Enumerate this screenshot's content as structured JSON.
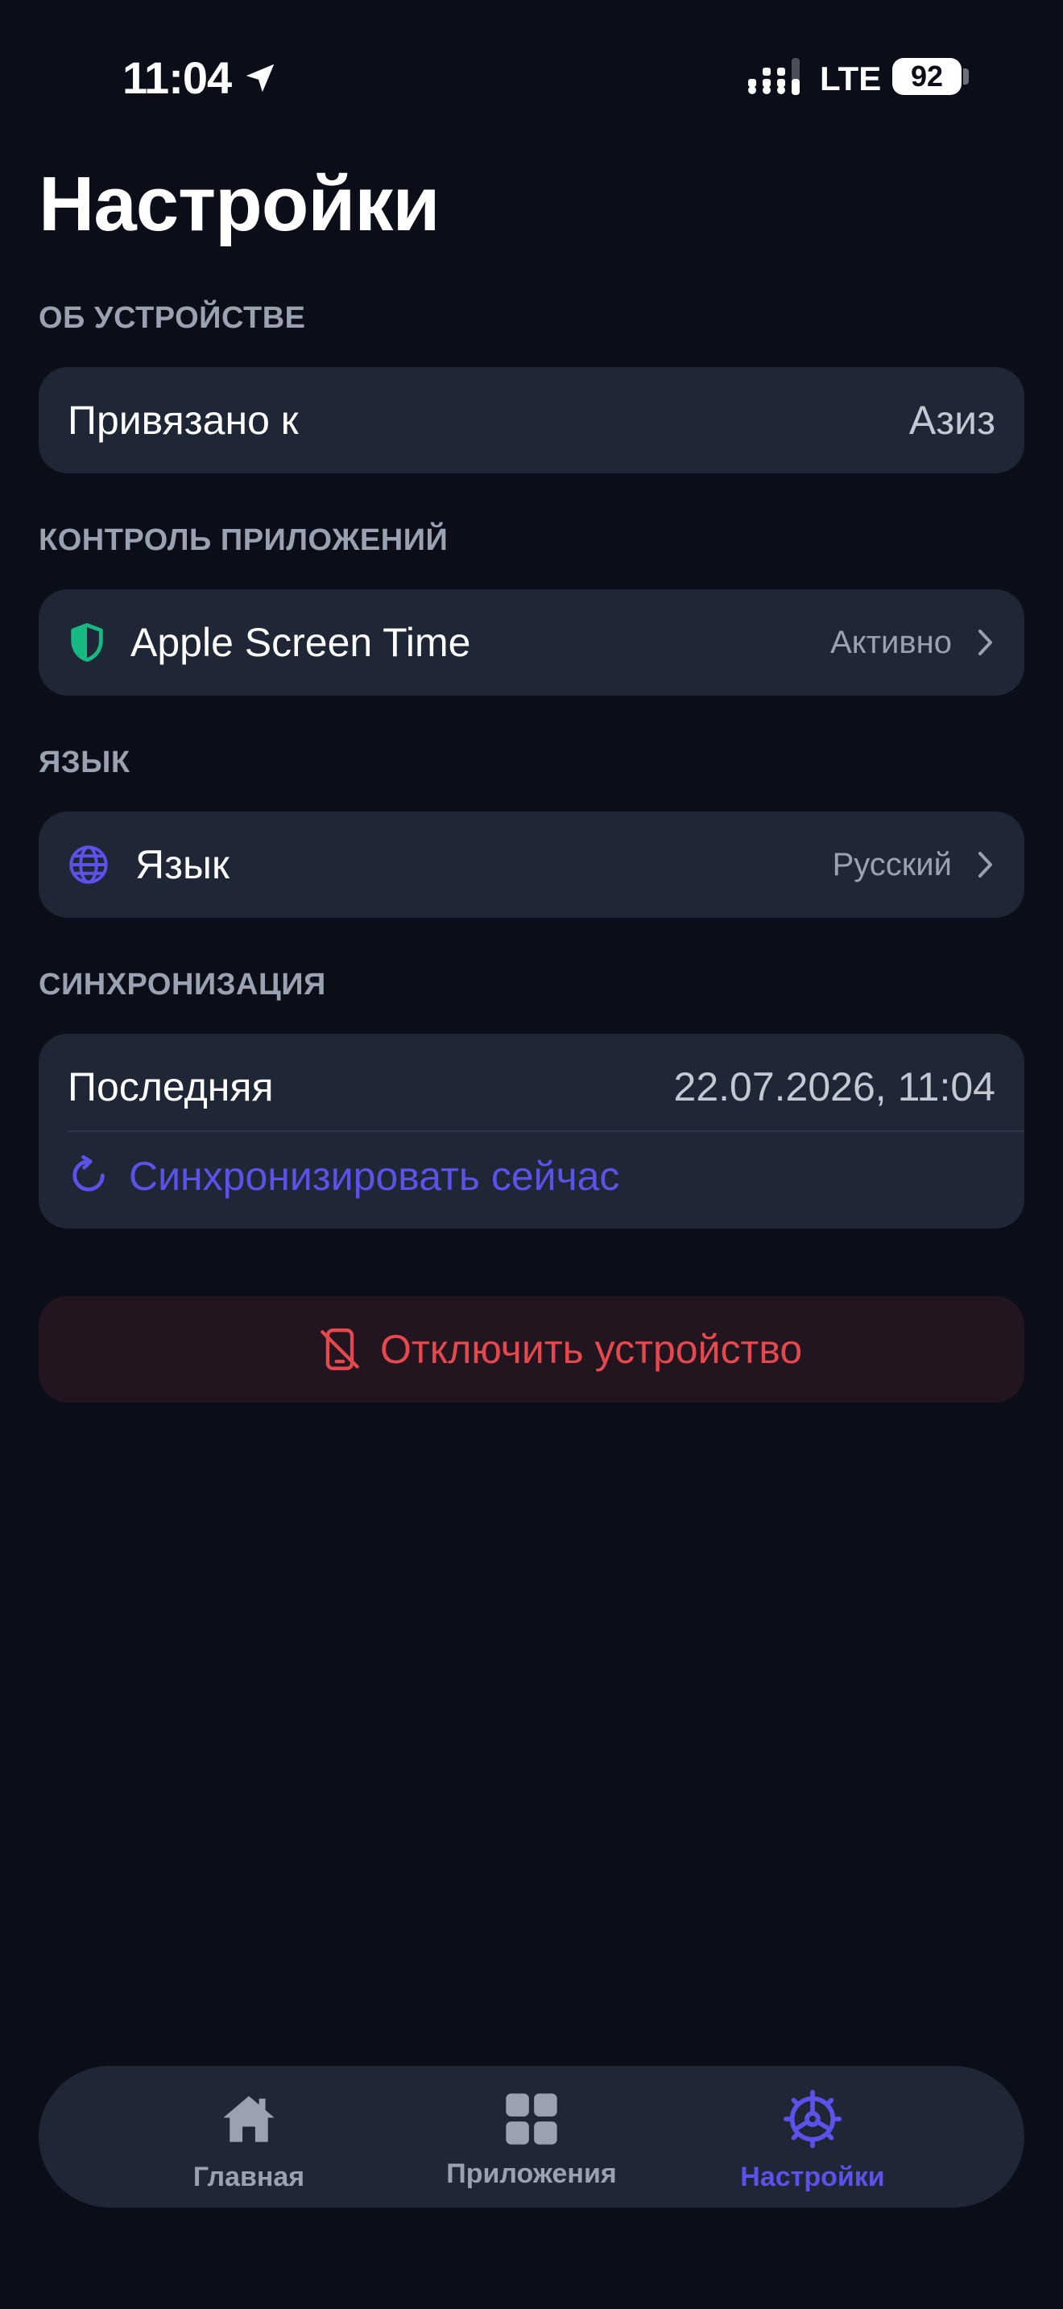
{
  "status_bar": {
    "time": "11:04",
    "network": "LTE",
    "battery": "92"
  },
  "page": {
    "title": "Настройки"
  },
  "sections": {
    "device": {
      "label": "ОБ УСТРОЙСТВЕ",
      "linked_label": "Привязано к",
      "linked_value": "Азиз"
    },
    "app_control": {
      "label": "КОНТРОЛЬ ПРИЛОЖЕНИЙ",
      "item_label": "Apple Screen Time",
      "item_status": "Активно",
      "icon": "shield-icon",
      "icon_color": "#16b982"
    },
    "language": {
      "label": "ЯЗЫК",
      "item_label": "Язык",
      "item_value": "Русский",
      "icon": "globe-icon"
    },
    "sync": {
      "label": "СИНХРОНИЗАЦИЯ",
      "last_label": "Последняя",
      "last_value": "22.07.2026, 11:04",
      "action_label": "Синхронизировать сейчас",
      "icon": "refresh-icon"
    }
  },
  "disconnect": {
    "label": "Отключить устройство",
    "icon": "phone-off-icon",
    "color": "#e5484d"
  },
  "tab_bar": {
    "tabs": [
      {
        "label": "Главная",
        "icon": "home-icon"
      },
      {
        "label": "Приложения",
        "icon": "grid-icon"
      },
      {
        "label": "Настройки",
        "icon": "gear-icon"
      }
    ],
    "active_index": 2,
    "accent_color": "#5b52ea"
  }
}
